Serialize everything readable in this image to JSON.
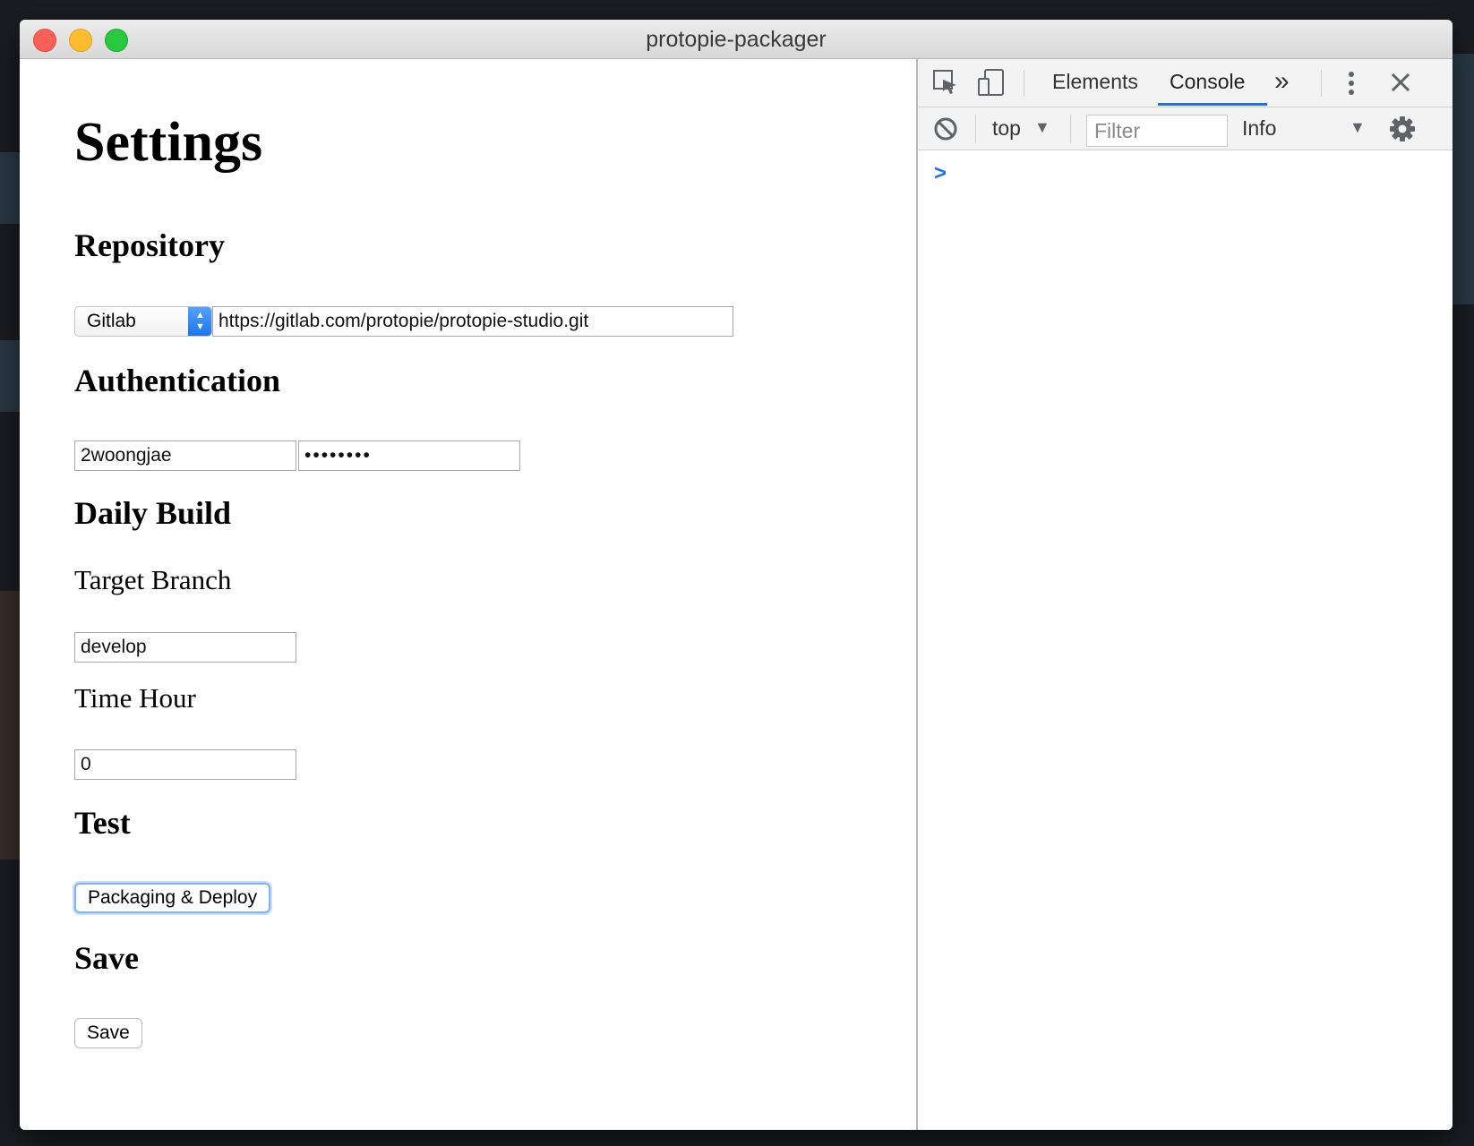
{
  "window": {
    "title": "protopie-packager"
  },
  "settings": {
    "page_title": "Settings",
    "repository": {
      "heading": "Repository",
      "provider_selected": "Gitlab",
      "url_value": "https://gitlab.com/protopie/protopie-studio.git"
    },
    "authentication": {
      "heading": "Authentication",
      "username_value": "2woongjae",
      "password_masked": "••••••••"
    },
    "daily_build": {
      "heading": "Daily Build",
      "target_branch_label": "Target Branch",
      "target_branch_value": "develop",
      "time_hour_label": "Time Hour",
      "time_hour_value": "0"
    },
    "test": {
      "heading": "Test",
      "button_label": "Packaging & Deploy"
    },
    "save": {
      "heading": "Save",
      "button_label": "Save"
    }
  },
  "devtools": {
    "tabs": [
      {
        "label": "Elements",
        "active": false
      },
      {
        "label": "Console",
        "active": true
      }
    ],
    "more_tabs_glyph": "»",
    "context_selected": "top",
    "filter_placeholder": "Filter",
    "level_selected": "Info",
    "console_prompt": ">",
    "accent_color": "#1a73e8"
  }
}
